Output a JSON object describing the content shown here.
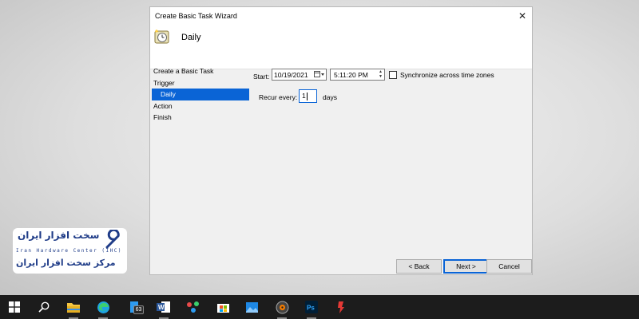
{
  "window": {
    "title": "Create Basic Task Wizard",
    "header_title": "Daily",
    "close_glyph": "✕"
  },
  "steps": [
    {
      "label": "Create a Basic Task",
      "active": false
    },
    {
      "label": "Trigger",
      "active": false
    },
    {
      "label": "Daily",
      "active": true
    },
    {
      "label": "Action",
      "active": false
    },
    {
      "label": "Finish",
      "active": false
    }
  ],
  "form": {
    "start_label": "Start:",
    "date_value": "10/19/2021",
    "time_value": "5:11:20 PM",
    "sync_label": "Synchronize across time zones",
    "sync_checked": false,
    "recur_label": "Recur every:",
    "recur_value": "1",
    "days_label": "days"
  },
  "buttons": {
    "back": "< Back",
    "next": "Next >",
    "cancel": "Cancel"
  },
  "logo": {
    "persian_top": "سخت افزار ایران",
    "english": "Iran  Hardware  Center  (IHC)",
    "persian_bottom": "مرکز سخت افزار ایران"
  },
  "taskbar": {
    "items": [
      {
        "icon": "windows-start-icon"
      },
      {
        "icon": "search-icon"
      },
      {
        "icon": "file-explorer-icon"
      },
      {
        "icon": "edge-icon"
      },
      {
        "icon": "app-icon",
        "badge": "63"
      },
      {
        "icon": "word-icon"
      },
      {
        "icon": "dots-app-icon"
      },
      {
        "icon": "store-icon"
      },
      {
        "icon": "photos-icon"
      },
      {
        "icon": "media-player-icon"
      },
      {
        "icon": "photoshop-icon"
      },
      {
        "icon": "tool-icon"
      }
    ]
  },
  "colors": {
    "accent": "#0a64d6",
    "taskbar": "#1c1c1c",
    "logo_blue": "#1f3c88"
  }
}
